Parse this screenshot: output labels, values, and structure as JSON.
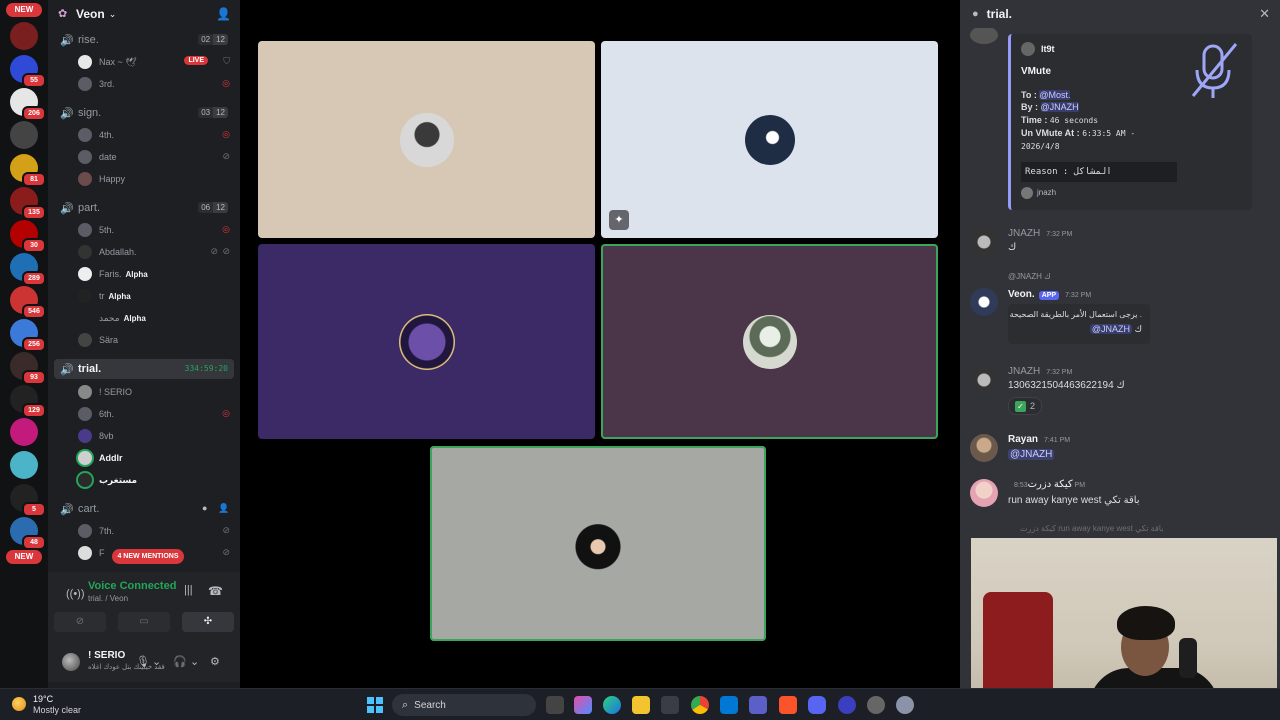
{
  "rail": {
    "new_top": "NEW",
    "new_bottom": "NEW",
    "servers": [
      {
        "name": "server-1",
        "count": "",
        "color": "#7a1f1f"
      },
      {
        "name": "server-2",
        "count": "55",
        "color": "#2e4ad6"
      },
      {
        "name": "server-3",
        "count": "206",
        "color": "#e6e6e6"
      },
      {
        "name": "server-4",
        "count": "",
        "color": "#444"
      },
      {
        "name": "server-5",
        "count": "81",
        "color": "#d4a017"
      },
      {
        "name": "server-6",
        "count": "135",
        "color": "#8a1c1c"
      },
      {
        "name": "server-7",
        "count": "30",
        "color": "#b30000"
      },
      {
        "name": "server-8",
        "count": "289",
        "color": "#1e6fb3"
      },
      {
        "name": "server-9",
        "count": "546",
        "color": "#cc3333"
      },
      {
        "name": "server-10",
        "count": "256",
        "color": "#3b7ad9"
      },
      {
        "name": "server-11",
        "count": "93",
        "color": "#3a2a2a"
      },
      {
        "name": "server-12",
        "count": "129",
        "color": "#222"
      },
      {
        "name": "server-13",
        "count": "",
        "color": "#c21a7d"
      },
      {
        "name": "server-14",
        "count": "",
        "color": "#4cb4c9"
      },
      {
        "name": "server-15",
        "count": "5",
        "color": "#222"
      },
      {
        "name": "server-16",
        "count": "48",
        "color": "#2b6cb0"
      }
    ]
  },
  "guild": {
    "name": "Veon"
  },
  "channels": [
    {
      "name": "rise.",
      "count_a": "02",
      "count_b": "12",
      "users": [
        {
          "name": "Nax ~ 🕊",
          "live": "LIVE",
          "bright": false
        },
        {
          "name": "3rd.",
          "live": "",
          "bright": false
        }
      ]
    },
    {
      "name": "sign.",
      "count_a": "03",
      "count_b": "12",
      "users": [
        {
          "name": "4th.",
          "tag": "",
          "bright": false
        },
        {
          "name": "date",
          "tag": "",
          "bright": false
        },
        {
          "name": "Happy",
          "tag": "",
          "bright": false
        }
      ]
    },
    {
      "name": "part.",
      "count_a": "06",
      "count_b": "12",
      "users": [
        {
          "name": "5th.",
          "tag": ""
        },
        {
          "name": "Abdallah.",
          "tag": ""
        },
        {
          "name": "Faris.",
          "tag": "Alpha"
        },
        {
          "name": "tr",
          "tag": "Alpha"
        },
        {
          "name": "محمد",
          "tag": "Alpha"
        },
        {
          "name": "Sära",
          "tag": ""
        }
      ]
    },
    {
      "name": "trial.",
      "timer": "334:59:20",
      "users": [
        {
          "name": "! SERIO",
          "bright": false
        },
        {
          "name": "6th.",
          "bright": false
        },
        {
          "name": "8vb",
          "bright": false
        },
        {
          "name": "Addlr",
          "bright": true
        },
        {
          "name": "مستغرب",
          "bright": true
        }
      ]
    },
    {
      "name": "cart.",
      "users": [
        {
          "name": "7th."
        },
        {
          "name": "F"
        }
      ]
    }
  ],
  "mentions_pill": "4 NEW MENTIONS",
  "voice": {
    "status": "Voice Connected",
    "location": "trial. / Veon"
  },
  "self": {
    "name": "! SERIO",
    "status": "فقد خيلينك بتل عودك اغلاه"
  },
  "chat": {
    "title": "trial.",
    "embed": {
      "author": "lt9t",
      "title": "VMute",
      "to_label": "To :",
      "to_value": "@Most.",
      "by_label": "By :",
      "by_value": "@JNAZH",
      "time_label": "Time :",
      "time_value": "46 seconds",
      "unmute_label": "Un VMute At :",
      "unmute_value": "6:33:5 AM -",
      "unmute_date": "2026/4/8",
      "reason": "Reason : المشاكل",
      "footer": "jnazh"
    },
    "messages": [
      {
        "author": "JNAZH",
        "time": "7:32 PM",
        "text": "ك"
      },
      {
        "reply": "@JNAZH ك",
        "author": "Veon.",
        "app": "APP",
        "time": "7:32 PM",
        "line1": "يرجى استعمال الأمر بالطريقة الصحيحة .",
        "mention": "@JNAZH",
        "line2_suffix": "ك"
      },
      {
        "author": "JNAZH",
        "time": "7:32 PM",
        "text": "1306321504463622194 ك",
        "reaction_count": "2"
      },
      {
        "author": "Rayan",
        "time": "7:41 PM",
        "mention": "@JNAZH"
      },
      {
        "author": "كيكة دزرت",
        "time": "8:53 PM",
        "text": "run away kanye west باقة تكي"
      }
    ],
    "faded_line": "كيكة دزرت run away kanye west باقة تكي"
  },
  "taskbar": {
    "temp": "19°C",
    "weather": "Mostly clear",
    "search_label": "Search"
  },
  "colors": {
    "accent_green": "#23a55a",
    "alert_red": "#da373c",
    "blurple": "#5865f2"
  }
}
